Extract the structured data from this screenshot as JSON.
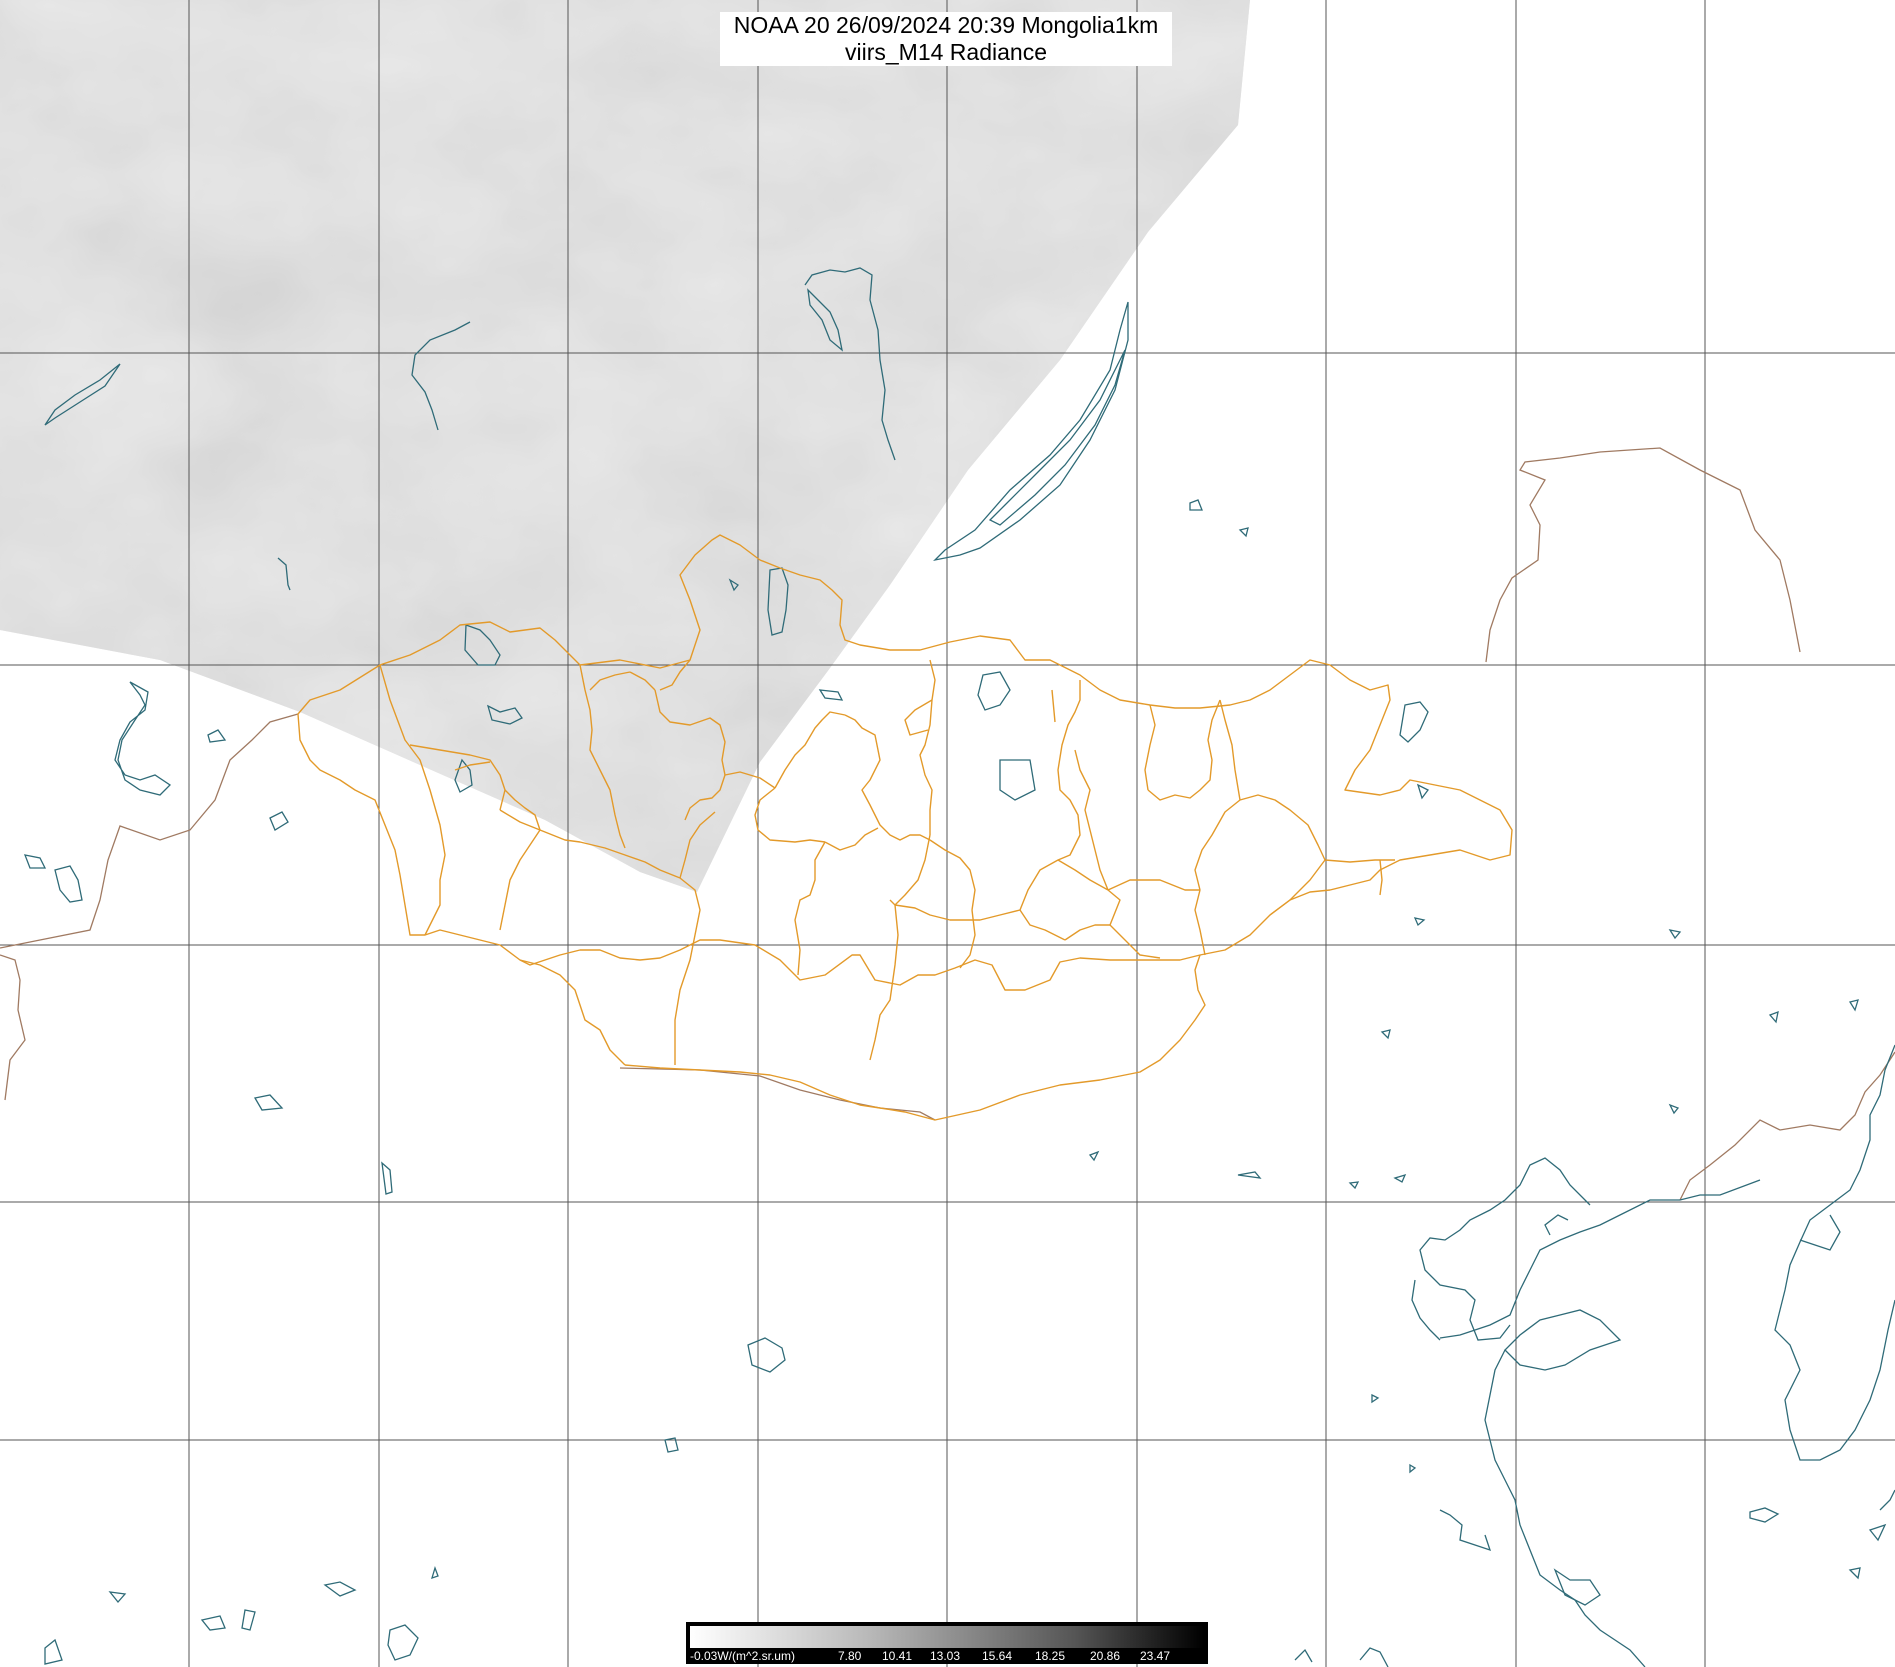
{
  "title": {
    "line1": "NOAA 20 26/09/2024 20:39 Mongolia1km",
    "line2": "viirs_M14 Radiance"
  },
  "legend": {
    "tick_labels": [
      "-0.03W/(m^2.sr.um)",
      "7.80",
      "10.41",
      "13.03",
      "15.64",
      "18.25",
      "20.86",
      "23.47"
    ]
  },
  "colors": {
    "background": "#ffffff",
    "grid": "#555555",
    "province_border": "#e39a2a",
    "coastline": "#2f6b78",
    "national_border": "#a07a62",
    "satellite_swath": "#d6d6d6"
  },
  "layers": [
    "satellite-swath",
    "graticule",
    "coastlines-lakes",
    "national-borders",
    "province-borders"
  ]
}
